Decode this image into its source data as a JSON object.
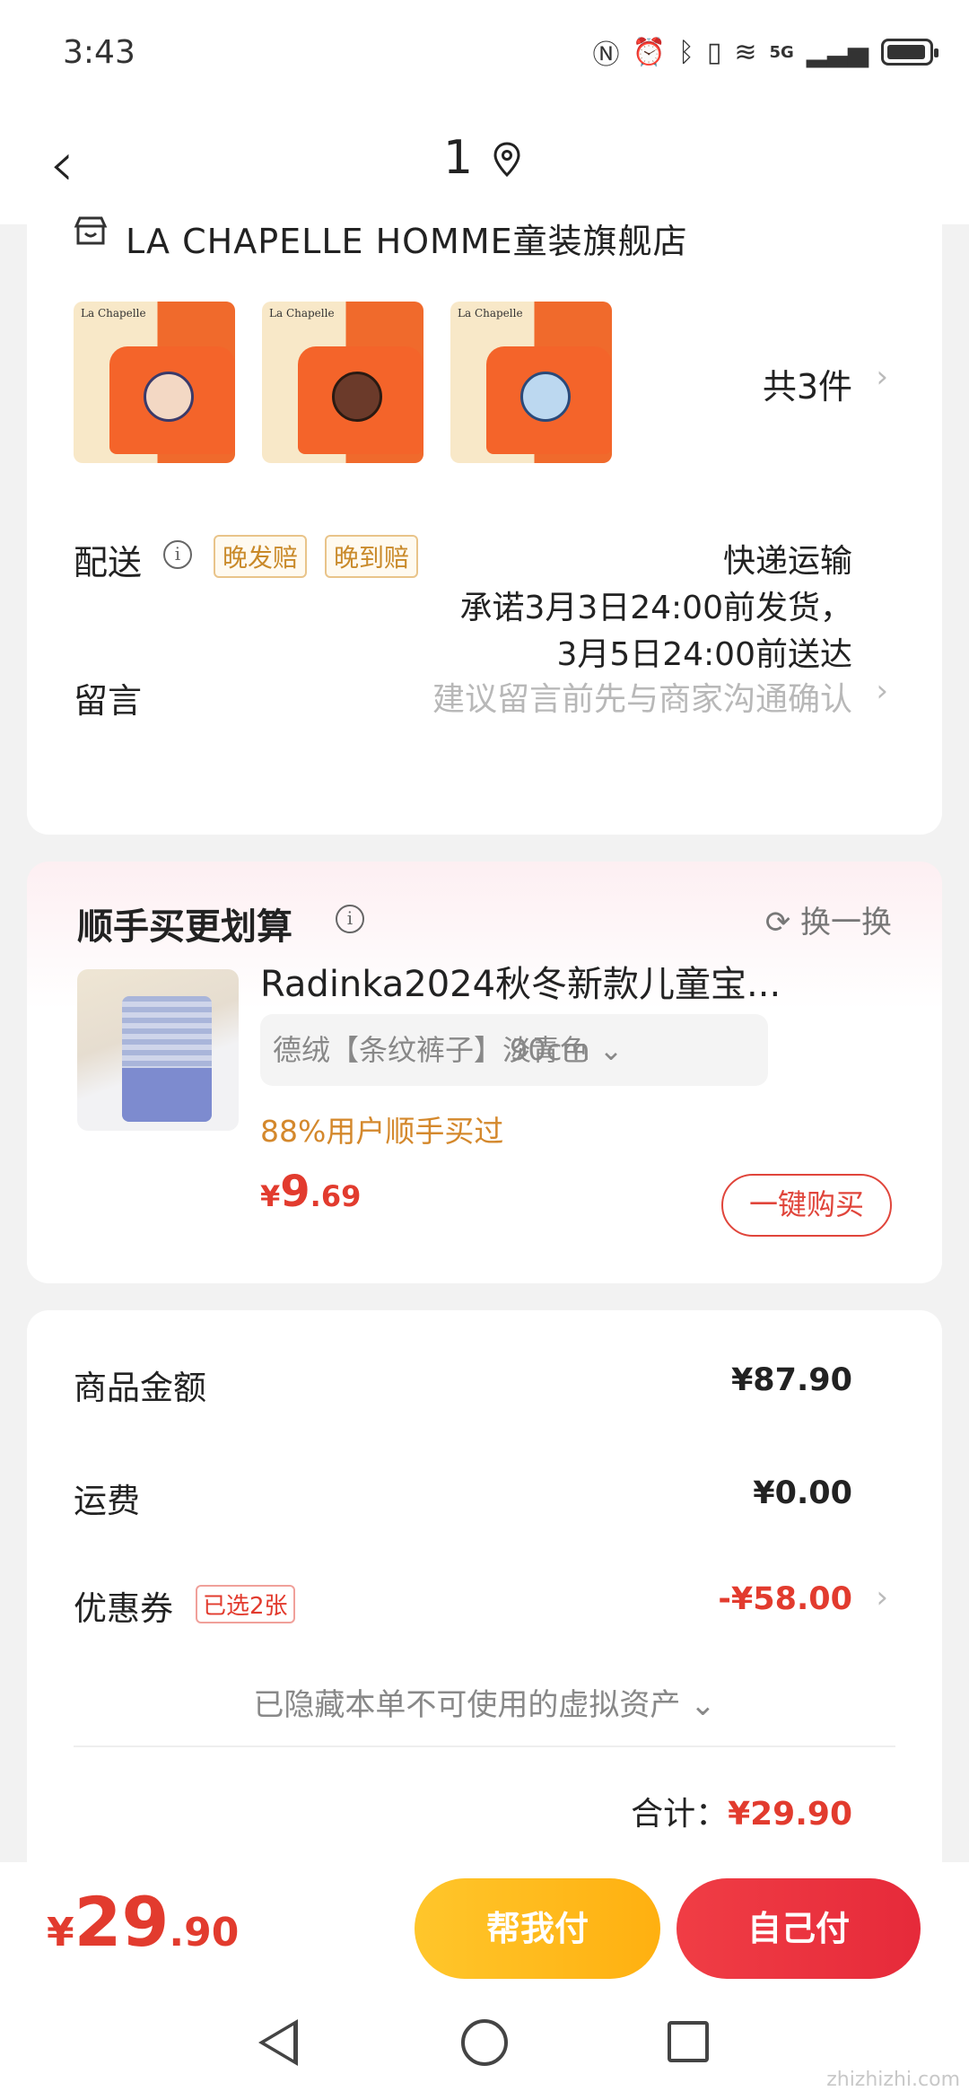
{
  "status": {
    "time": "3:43",
    "network": "5G"
  },
  "nav": {
    "title": "1"
  },
  "store": {
    "name": "LA CHAPELLE HOMME童装旗舰店",
    "thumb_brand": "La Chapelle",
    "item_count": "共3件"
  },
  "delivery": {
    "label": "配送",
    "tags": [
      "晚发赔",
      "晚到赔"
    ],
    "method": "快递运输",
    "promise_line1": "承诺3月3日24:00前发货，",
    "promise_line2": "3月5日24:00前送达"
  },
  "note": {
    "label": "留言",
    "placeholder": "建议留言前先与商家沟通确认"
  },
  "combo": {
    "title": "顺手买更划算",
    "refresh_label": "换一换",
    "product_name": "Radinka2024秋冬新款儿童宝...",
    "sku_option": "德绒【条纹裤子】淡青色",
    "sku_size": "90cm",
    "purchase_rate": "88%用户顺手买过",
    "price_currency": "¥",
    "price_int": "9",
    "price_dec": ".69",
    "buy_label": "一键购买"
  },
  "summary": {
    "goods_label": "商品金额",
    "goods_value": "¥87.90",
    "shipping_label": "运费",
    "shipping_value": "¥0.00",
    "coupon_label": "优惠券",
    "coupon_tag": "已选2张",
    "coupon_value": "-¥58.00",
    "hidden_note": "已隐藏本单不可使用的虚拟资产",
    "total_label": "合计：",
    "total_value": "¥29.90"
  },
  "bottom": {
    "price_currency": "¥",
    "price_int": "29",
    "price_dec": ".90",
    "help_pay_label": "帮我付",
    "self_pay_label": "自己付"
  },
  "watermark": "zhizhizhi.com",
  "colors": {
    "accent_red": "#e23b2e",
    "help_yellow": "#ffc62b",
    "pay_red": "#f03d45",
    "tag_orange": "#c98a2a"
  }
}
